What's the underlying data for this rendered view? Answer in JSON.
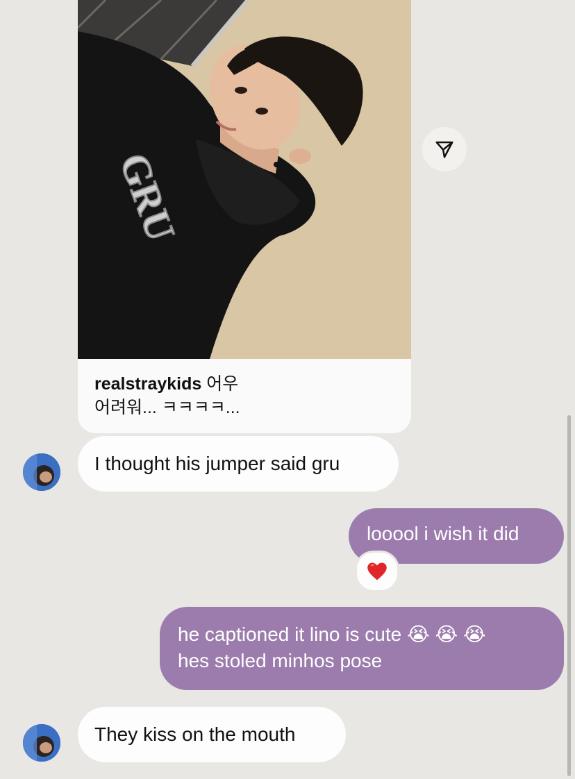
{
  "shared_post": {
    "username": "realstraykids",
    "caption_line1": "어우",
    "caption_line2": "어려워... ㅋㅋㅋㅋ...",
    "hoodie_text": "GRU"
  },
  "messages": [
    {
      "direction": "incoming",
      "text": "I thought his jumper said gru"
    },
    {
      "direction": "outgoing",
      "text": "looool i wish it did",
      "reaction": "❤️"
    },
    {
      "direction": "outgoing",
      "line1": "he captioned it lino is cute 😭 😭 😭",
      "line2": "hes stoled minhos pose"
    },
    {
      "direction": "incoming",
      "text": "They kiss on the mouth"
    }
  ],
  "icons": {
    "share": "paper-plane-icon",
    "reaction": "heart-icon"
  },
  "colors": {
    "background": "#e9e7e3",
    "outgoing_bubble": "#9b7cad",
    "incoming_bubble": "#fdfdfd"
  }
}
